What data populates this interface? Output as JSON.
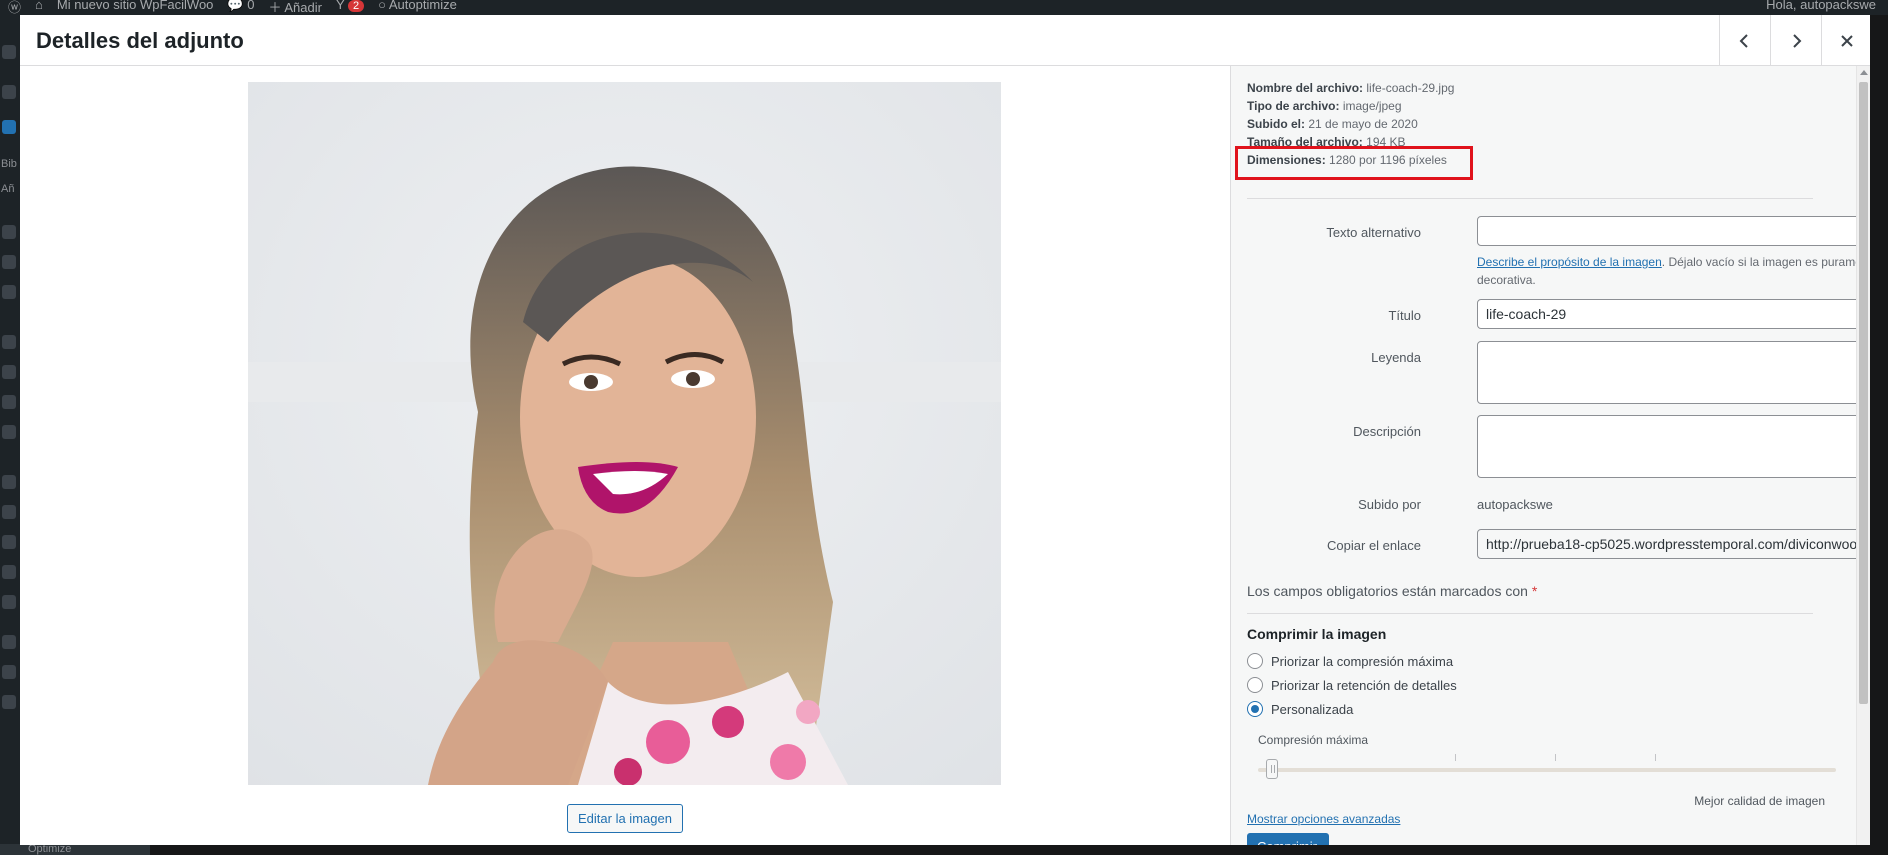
{
  "adminbar": {
    "site_name": "Mi nuevo sitio WpFacilWoo",
    "comments": "0",
    "add_new": "Añadir",
    "updates_badge": "2",
    "autoptimize": "Autoptimize",
    "greeting": "Hola, autopackswe"
  },
  "adminmenu": {
    "library_abbrev": "Bib",
    "add_abbrev": "Añ"
  },
  "footer": {
    "optimize_label": "Optimize"
  },
  "modal": {
    "title": "Detalles del adjunto",
    "prev_label": "Adjunto anterior",
    "next_label": "Adjunto siguiente",
    "close_label": "Cerrar"
  },
  "image": {
    "edit_button": "Editar la imagen"
  },
  "details": {
    "filename_label": "Nombre del archivo:",
    "filename": "life-coach-29.jpg",
    "filetype_label": "Tipo de archivo:",
    "filetype": "image/jpeg",
    "uploaded_label": "Subido el:",
    "uploaded": "21 de mayo de 2020",
    "size_label": "Tamaño del archivo:",
    "size": "194 KB",
    "dimensions_label": "Dimensiones:",
    "dimensions": "1280 por 1196 píxeles"
  },
  "fields": {
    "alt_label": "Texto alternativo",
    "alt_value": "",
    "alt_help_link": "Describe el propósito de la imagen",
    "alt_help_text": ". Déjalo vacío si la imagen es puramente decorativa.",
    "title_label": "Título",
    "title_value": "life-coach-29",
    "caption_label": "Leyenda",
    "description_label": "Descripción",
    "uploaded_by_label": "Subido por",
    "uploaded_by": "autopackswe",
    "copy_link_label": "Copiar el enlace",
    "copy_link_value": "http://prueba18-cp5025.wordpresstemporal.com/diviconwoo"
  },
  "required_note": {
    "text": "Los campos obligatorios están marcados con",
    "star": "*"
  },
  "compress": {
    "title": "Comprimir la imagen",
    "options": [
      {
        "label": "Priorizar la compresión máxima",
        "checked": false
      },
      {
        "label": "Priorizar la retención de detalles",
        "checked": false
      },
      {
        "label": "Personalizada",
        "checked": true
      }
    ],
    "slider_label": "Compresión máxima",
    "slider_level": 0.02,
    "slider_right_label": "Mejor calidad de imagen",
    "advanced_link": "Mostrar opciones avanzadas",
    "button": "Comprimir"
  },
  "colors": {
    "accent": "#2271b1",
    "highlight": "#e0131c",
    "required": "#d63638"
  }
}
